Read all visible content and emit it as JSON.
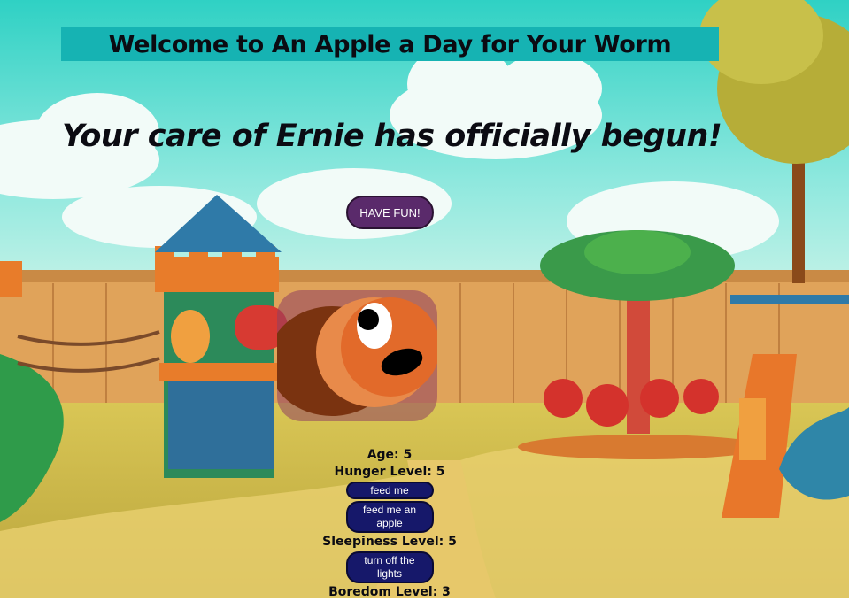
{
  "header": {
    "title": "Welcome to An Apple a Day for Your Worm",
    "subtitle": "Your care of Ernie has officially begun!",
    "fun_button": "HAVE FUN!"
  },
  "stats": {
    "age": "Age: 5",
    "hunger": "Hunger Level: 5",
    "feed_button": "feed me",
    "apple_button": "feed me an apple",
    "sleepiness": "Sleepiness Level: 5",
    "lights_button": "turn off the lights",
    "boredom": "Boredom Level: 3"
  },
  "colors": {
    "title_bg": "#16b3b3",
    "fun_button_bg": "#5a2a6b",
    "action_button_bg": "#16186a"
  }
}
